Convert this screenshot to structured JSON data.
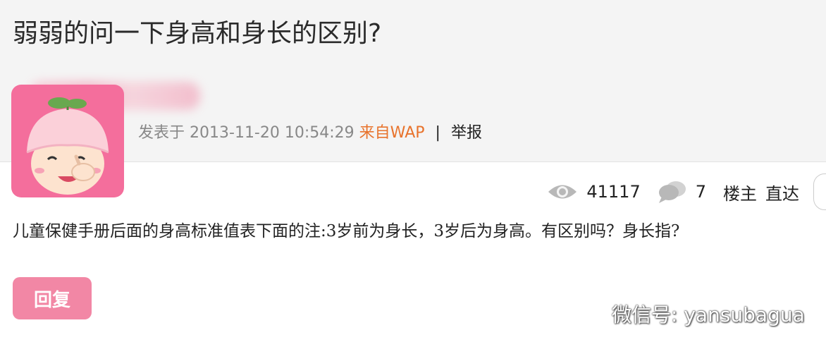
{
  "post": {
    "title": "弱弱的问一下身高和身长的区别?",
    "meta": {
      "prefix": "发表于",
      "timestamp": "2013-11-20 10:54:29",
      "source": "来自WAP",
      "separator": "|",
      "report": "举报"
    },
    "stats": {
      "views": "41117",
      "replies": "7",
      "owner_link": "楼主",
      "jump": "直达"
    },
    "content": "儿童保健手册后面的身高标准值表下面的注:3岁前为身长，3岁后为身高。有区别吗？身长指?",
    "reply_label": "回复"
  },
  "icons": {
    "views": "eye-icon",
    "replies": "comment-bubble-icon",
    "watermark": "wechat-icon"
  },
  "watermark": {
    "text": "微信号: yansubagua"
  },
  "colors": {
    "header_bg": "#f4f4f4",
    "source": "#e8732c",
    "reply_button": "#f287a5",
    "avatar_bg": "#f46e9c"
  }
}
